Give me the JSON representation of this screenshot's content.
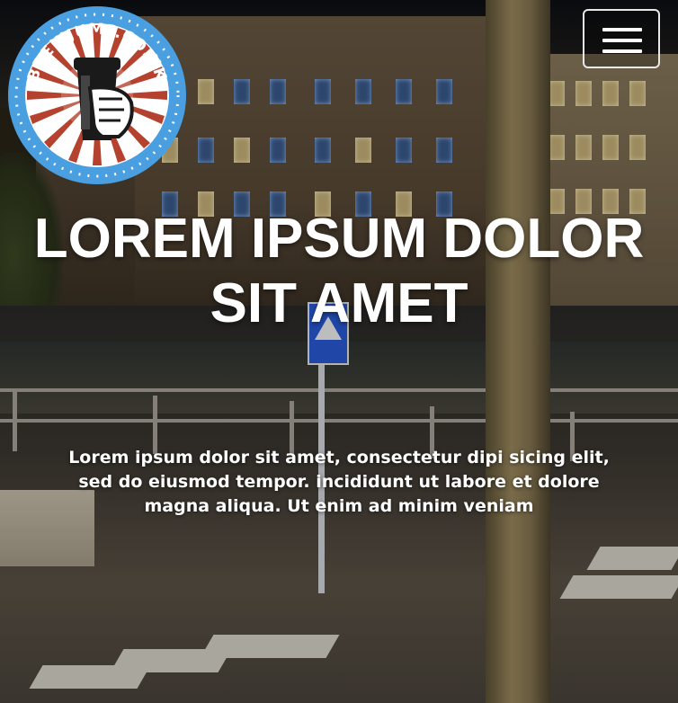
{
  "header": {
    "logo_text": "BREWJUMP.CO.UK",
    "menu_icon": "hamburger-menu-icon"
  },
  "hero": {
    "title": "LOREM IPSUM DOLOR SIT AMET",
    "text": "Lorem ipsum dolor sit amet, consectetur dipi sicing elit, sed do eiusmod tempor. incididunt ut labore et dolore magna aliqua. Ut enim ad minim veniam"
  },
  "colors": {
    "logo_blue": "#4a9fe0",
    "logo_red": "#b5422e",
    "text": "#ffffff"
  }
}
